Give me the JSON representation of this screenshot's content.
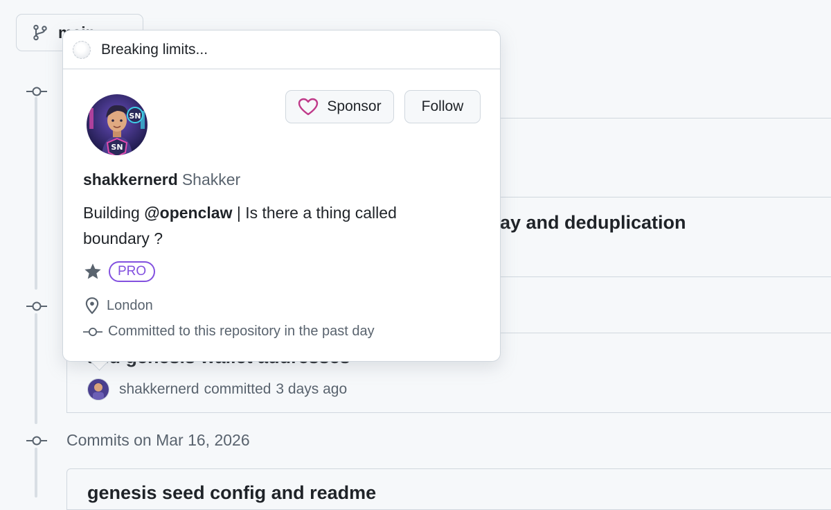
{
  "branch": {
    "label": "main",
    "icon": "git-branch-icon"
  },
  "timeline": {
    "groups": [
      {
        "label": "Commits on Mar 16, 2026"
      }
    ],
    "commits": [
      {
        "title_partial": "ay and deduplication"
      },
      {
        "title_partial": "add genesis wallet addresses",
        "author": "shakkernerd",
        "action": "committed",
        "time": "3 days ago"
      },
      {
        "title_partial": "genesis seed config and readme"
      }
    ]
  },
  "hovercard": {
    "status": "Breaking limits...",
    "sponsor_label": "Sponsor",
    "follow_label": "Follow",
    "login": "shakkernerd",
    "name": "Shakker",
    "bio_prefix": "Building ",
    "bio_mention": "@openclaw",
    "bio_suffix": " | Is there a thing called boundary ?",
    "badge": "PRO",
    "location": "London",
    "contribution": "Committed to this repository in the past day",
    "colors": {
      "sponsor_heart": "#bf3989",
      "pro": "#8250df"
    }
  }
}
